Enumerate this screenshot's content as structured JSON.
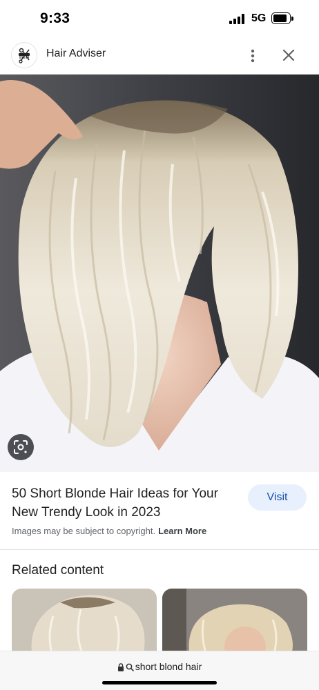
{
  "status_bar": {
    "time": "9:33",
    "network": "5G",
    "signal_icon": "cellular-signal-icon",
    "battery_icon": "battery-icon"
  },
  "header": {
    "site_name": "Hair Adviser",
    "logo_icon": "scissors-comb-logo",
    "more_icon": "more-vertical-icon",
    "close_icon": "close-icon"
  },
  "main_image": {
    "lens_icon": "google-lens-icon"
  },
  "result": {
    "title": "50 Short Blonde Hair Ideas for Your New Trendy Look in 2023",
    "visit_label": "Visit",
    "copyright_text": "Images may be subject to copyright.",
    "learn_more_label": "Learn More"
  },
  "related": {
    "heading": "Related content"
  },
  "url_bar": {
    "lock_icon": "lock-icon",
    "search_icon": "search-icon",
    "text": "short blond hair"
  },
  "colors": {
    "visit_bg": "#e8f0fe",
    "visit_text": "#174ea6",
    "lens_bg": "#28282f"
  }
}
